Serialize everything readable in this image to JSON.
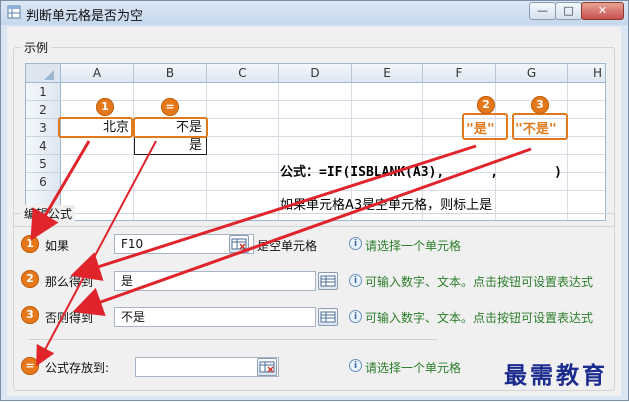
{
  "window": {
    "title": "判断单元格是否为空"
  },
  "controls": {
    "minimize": "—",
    "maximize": "□",
    "close": "✕"
  },
  "example": {
    "group_label": "示例",
    "columns": [
      "A",
      "B",
      "C",
      "D",
      "E",
      "F",
      "G",
      "H"
    ],
    "rows": [
      "1",
      "2",
      "3",
      "4",
      "5",
      "6"
    ],
    "cells": {
      "A3": "北京",
      "B3": "不是",
      "B4": "是"
    },
    "formula": "公式：=IF(ISBLANK(A3),",
    "formula_comma": ",",
    "formula_close": ")",
    "q_yes": "\"是\"",
    "q_no": "\"不是\"",
    "explanation": "如果单元格A3是空单元格，则标上是"
  },
  "badges": {
    "b1": "1",
    "b2": "2",
    "b3": "3",
    "beq": "="
  },
  "edit": {
    "group_label": "编辑公式",
    "if_label": "如果",
    "if_value": "F10",
    "if_suffix": "是空单元格",
    "if_hint": "请选择一个单元格",
    "then_label": "那么得到",
    "then_value": "是",
    "then_hint": "可输入数字、文本。点击按钮可设置表达式",
    "else_label": "否则得到",
    "else_value": "不是",
    "else_hint": "可输入数字、文本。点击按钮可设置表达式",
    "store_label": "公式存放到:",
    "store_value": "",
    "store_hint": "请选择一个单元格",
    "info_glyph": "i"
  },
  "watermark": "最需教育",
  "colors": {
    "accent": "#e5781a",
    "hint": "#2b7d2b",
    "arrow": "#e0242c"
  }
}
